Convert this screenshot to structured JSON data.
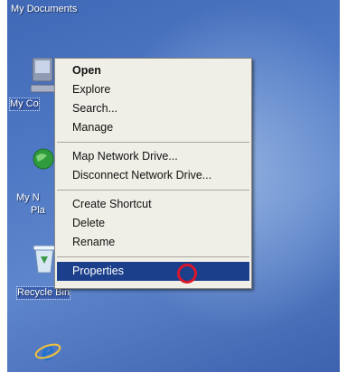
{
  "desktop": {
    "icons": [
      {
        "label": "My Documents",
        "icon": "my-documents-icon"
      },
      {
        "label": "My Co",
        "icon": "my-computer-icon"
      },
      {
        "label": "My N",
        "label2": "Pla",
        "icon": "my-network-places-icon"
      },
      {
        "label": "Recycle Bin",
        "icon": "recycle-bin-icon"
      },
      {
        "label": "",
        "icon": "internet-explorer-icon"
      }
    ]
  },
  "context_menu": {
    "groups": [
      [
        {
          "label": "Open",
          "bold": true
        },
        {
          "label": "Explore"
        },
        {
          "label": "Search..."
        },
        {
          "label": "Manage"
        }
      ],
      [
        {
          "label": "Map Network Drive..."
        },
        {
          "label": "Disconnect Network Drive..."
        }
      ],
      [
        {
          "label": "Create Shortcut"
        },
        {
          "label": "Delete"
        },
        {
          "label": "Rename"
        }
      ],
      [
        {
          "label": "Properties",
          "highlighted": true
        }
      ]
    ]
  },
  "colors": {
    "highlight": "#1b3f8a",
    "annotation_ring": "#d8162c"
  }
}
